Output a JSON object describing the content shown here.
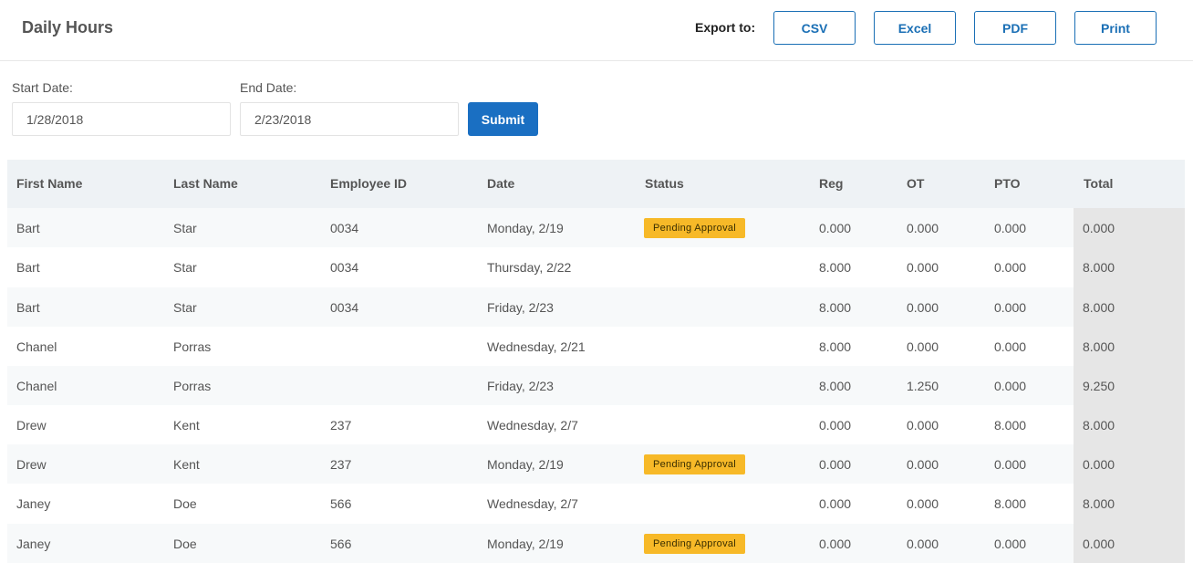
{
  "header": {
    "title": "Daily Hours",
    "export_label": "Export to:",
    "export_buttons": [
      "CSV",
      "Excel",
      "PDF",
      "Print"
    ]
  },
  "filters": {
    "start_label": "Start Date:",
    "start_value": "1/28/2018",
    "end_label": "End Date:",
    "end_value": "2/23/2018",
    "submit_label": "Submit"
  },
  "table": {
    "columns": [
      "First Name",
      "Last Name",
      "Employee ID",
      "Date",
      "Status",
      "Reg",
      "OT",
      "PTO",
      "Total"
    ],
    "rows": [
      {
        "first": "Bart",
        "last": "Star",
        "id": "0034",
        "date": "Monday, 2/19",
        "status": "Pending Approval",
        "reg": "0.000",
        "ot": "0.000",
        "pto": "0.000",
        "total": "0.000"
      },
      {
        "first": "Bart",
        "last": "Star",
        "id": "0034",
        "date": "Thursday, 2/22",
        "status": "",
        "reg": "8.000",
        "ot": "0.000",
        "pto": "0.000",
        "total": "8.000"
      },
      {
        "first": "Bart",
        "last": "Star",
        "id": "0034",
        "date": "Friday, 2/23",
        "status": "",
        "reg": "8.000",
        "ot": "0.000",
        "pto": "0.000",
        "total": "8.000"
      },
      {
        "first": "Chanel",
        "last": "Porras",
        "id": "",
        "date": "Wednesday, 2/21",
        "status": "",
        "reg": "8.000",
        "ot": "0.000",
        "pto": "0.000",
        "total": "8.000"
      },
      {
        "first": "Chanel",
        "last": "Porras",
        "id": "",
        "date": "Friday, 2/23",
        "status": "",
        "reg": "8.000",
        "ot": "1.250",
        "pto": "0.000",
        "total": "9.250"
      },
      {
        "first": "Drew",
        "last": "Kent",
        "id": "237",
        "date": "Wednesday, 2/7",
        "status": "",
        "reg": "0.000",
        "ot": "0.000",
        "pto": "8.000",
        "total": "8.000"
      },
      {
        "first": "Drew",
        "last": "Kent",
        "id": "237",
        "date": "Monday, 2/19",
        "status": "Pending Approval",
        "reg": "0.000",
        "ot": "0.000",
        "pto": "0.000",
        "total": "0.000"
      },
      {
        "first": "Janey",
        "last": "Doe",
        "id": "566",
        "date": "Wednesday, 2/7",
        "status": "",
        "reg": "0.000",
        "ot": "0.000",
        "pto": "8.000",
        "total": "8.000"
      },
      {
        "first": "Janey",
        "last": "Doe",
        "id": "566",
        "date": "Monday, 2/19",
        "status": "Pending Approval",
        "reg": "0.000",
        "ot": "0.000",
        "pto": "0.000",
        "total": "0.000"
      }
    ]
  },
  "colors": {
    "accent": "#1a6fc2",
    "badge": "#f7b928",
    "header_bg": "#eef2f5",
    "total_bg": "#e6e6e6"
  }
}
